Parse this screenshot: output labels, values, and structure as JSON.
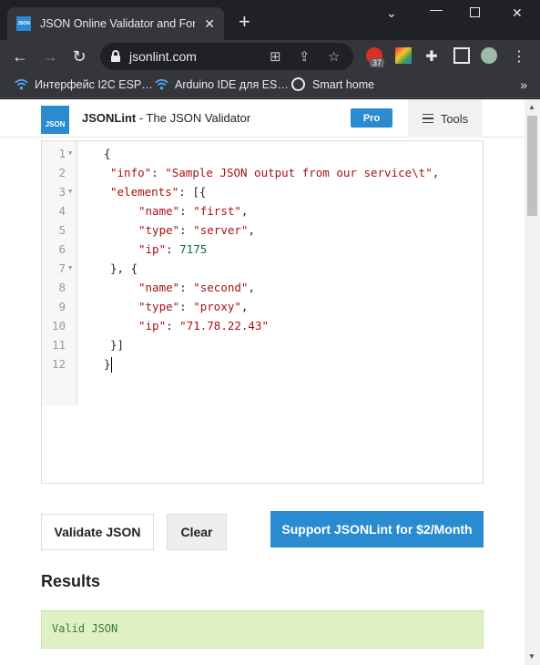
{
  "browser": {
    "tab_title": "JSON Online Validator and Formatter - JSON Lint",
    "tab_favicon_text": "JSON",
    "url": "jsonlint.com",
    "extension_badge": "37",
    "bookmarks": [
      {
        "label": "Интерфейс I2C ESP…"
      },
      {
        "label": "Arduino IDE для ES…"
      },
      {
        "label": "Smart home"
      }
    ]
  },
  "site": {
    "logo_text": "JSON",
    "brand_name": "JSONLint",
    "brand_tagline": " - The JSON Validator",
    "pro_label": "Pro",
    "tools_label": "Tools"
  },
  "editor": {
    "lines": [
      {
        "n": "1",
        "fold": true
      },
      {
        "n": "2",
        "fold": false
      },
      {
        "n": "3",
        "fold": true
      },
      {
        "n": "4",
        "fold": false
      },
      {
        "n": "5",
        "fold": false
      },
      {
        "n": "6",
        "fold": false
      },
      {
        "n": "7",
        "fold": true
      },
      {
        "n": "8",
        "fold": false
      },
      {
        "n": "9",
        "fold": false
      },
      {
        "n": "10",
        "fold": false
      },
      {
        "n": "11",
        "fold": false
      },
      {
        "n": "12",
        "fold": false
      }
    ],
    "tokens": {
      "info_key": "\"info\"",
      "info_val": "\"Sample JSON output from our service\\t\"",
      "elements_key": "\"elements\"",
      "name_key": "\"name\"",
      "type_key": "\"type\"",
      "ip_key": "\"ip\"",
      "first": "\"first\"",
      "server": "\"server\"",
      "ip1": "7175",
      "second": "\"second\"",
      "proxy": "\"proxy\"",
      "ip2": "\"71.78.22.43\""
    }
  },
  "actions": {
    "validate_label": "Validate JSON",
    "clear_label": "Clear",
    "support_label": "Support JSONLint for $2/Month"
  },
  "results": {
    "heading": "Results",
    "message": "Valid JSON"
  },
  "colors": {
    "brand_blue": "#2a8bd1",
    "valid_bg": "#dff0c5",
    "valid_text": "#3c763d"
  }
}
